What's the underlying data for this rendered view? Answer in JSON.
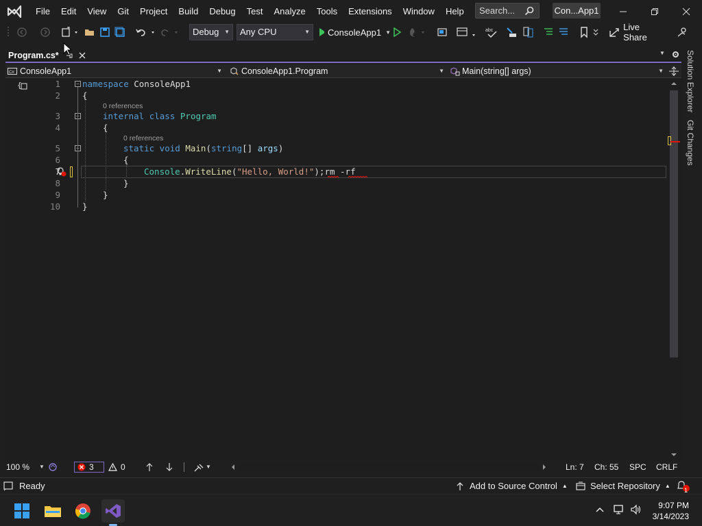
{
  "menu": {
    "items": [
      "File",
      "Edit",
      "View",
      "Git",
      "Project",
      "Build",
      "Debug",
      "Test",
      "Analyze",
      "Tools",
      "Extensions",
      "Window",
      "Help"
    ],
    "search_placeholder": "Search...",
    "solution_name": "Con...App1"
  },
  "toolbar": {
    "configuration": "Debug",
    "platform": "Any CPU",
    "run_target": "ConsoleApp1",
    "live_share": "Live Share"
  },
  "document_tab": {
    "title": "Program.cs*"
  },
  "navbar": {
    "project": "ConsoleApp1",
    "type": "ConsoleApp1.Program",
    "member": "Main(string[] args)"
  },
  "editor": {
    "line_numbers": [
      "1",
      "2",
      "3",
      "4",
      "5",
      "6",
      "7",
      "8",
      "9",
      "10"
    ],
    "codelens": [
      "0 references",
      "0 references"
    ],
    "lines": {
      "l1_kw": "namespace",
      "l1_name": " ConsoleApp1",
      "l2": "{",
      "l3_kw": "internal class",
      "l3_type": "Program",
      "l4": "{",
      "l5_kw": "static void",
      "l5_method": "Main",
      "l5_open": "(",
      "l5_ptype": "string",
      "l5_rest": "[] ",
      "l5_param": "args",
      "l5_close": ")",
      "l6": "{",
      "l7_type": "Console",
      "l7_dot": ".",
      "l7_method": "WriteLine",
      "l7_open": "(",
      "l7_str": "\"Hello, World!\"",
      "l7_close": ");",
      "l7_extra": "rm -rf",
      "l8": "}",
      "l9": "}",
      "l10": "}"
    }
  },
  "editor_status": {
    "zoom": "100 %",
    "errors": "3",
    "warnings": "0",
    "line": "Ln: 7",
    "char": "Ch: 55",
    "whitespace": "SPC",
    "line_ending": "CRLF"
  },
  "statusbar": {
    "state": "Ready",
    "source_control": "Add to Source Control",
    "repository": "Select Repository",
    "notifications": "1"
  },
  "side_tabs": [
    "Solution Explorer",
    "Git Changes"
  ],
  "taskbar": {
    "time": "9:07 PM",
    "date": "3/14/2023"
  },
  "colors": {
    "accent": "#7f6ac5",
    "keyword": "#569cd6",
    "type": "#4ec9b0",
    "method": "#dcdcaa",
    "string": "#d69d85",
    "error": "#e51400"
  }
}
